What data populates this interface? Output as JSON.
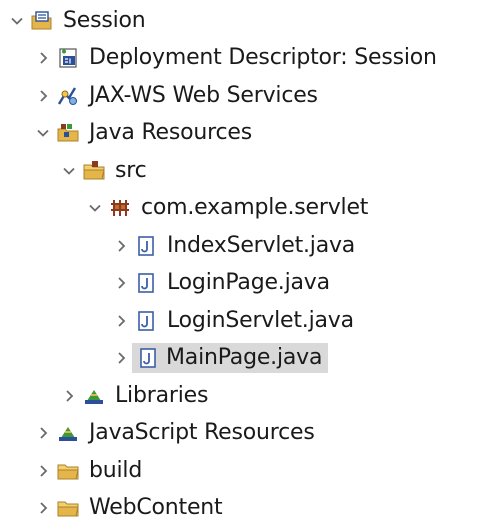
{
  "tree": {
    "project": {
      "label": "Session",
      "expanded": true
    },
    "deployment_descriptor": {
      "label": "Deployment Descriptor: Session",
      "expanded": false
    },
    "jaxws": {
      "label": "JAX-WS Web Services",
      "expanded": false
    },
    "java_resources": {
      "label": "Java Resources",
      "expanded": true
    },
    "src": {
      "label": "src",
      "expanded": true
    },
    "package": {
      "label": "com.example.servlet",
      "expanded": true
    },
    "files": [
      {
        "label": "IndexServlet.java",
        "selected": false
      },
      {
        "label": "LoginPage.java",
        "selected": false
      },
      {
        "label": "LoginServlet.java",
        "selected": false
      },
      {
        "label": "MainPage.java",
        "selected": true
      }
    ],
    "libraries": {
      "label": "Libraries",
      "expanded": false
    },
    "javascript_resources": {
      "label": "JavaScript Resources",
      "expanded": false
    },
    "build": {
      "label": "build",
      "expanded": false
    },
    "webcontent": {
      "label": "WebContent",
      "expanded": false
    }
  },
  "colors": {
    "selection": "#d9d9d9",
    "chevron": "#6a6a6a",
    "folder": "#e6b54a",
    "java_file_border": "#3b5fa8",
    "package": "#8b3a1d",
    "library_green": "#3a9a3a",
    "library_blue": "#2c4f9a"
  }
}
